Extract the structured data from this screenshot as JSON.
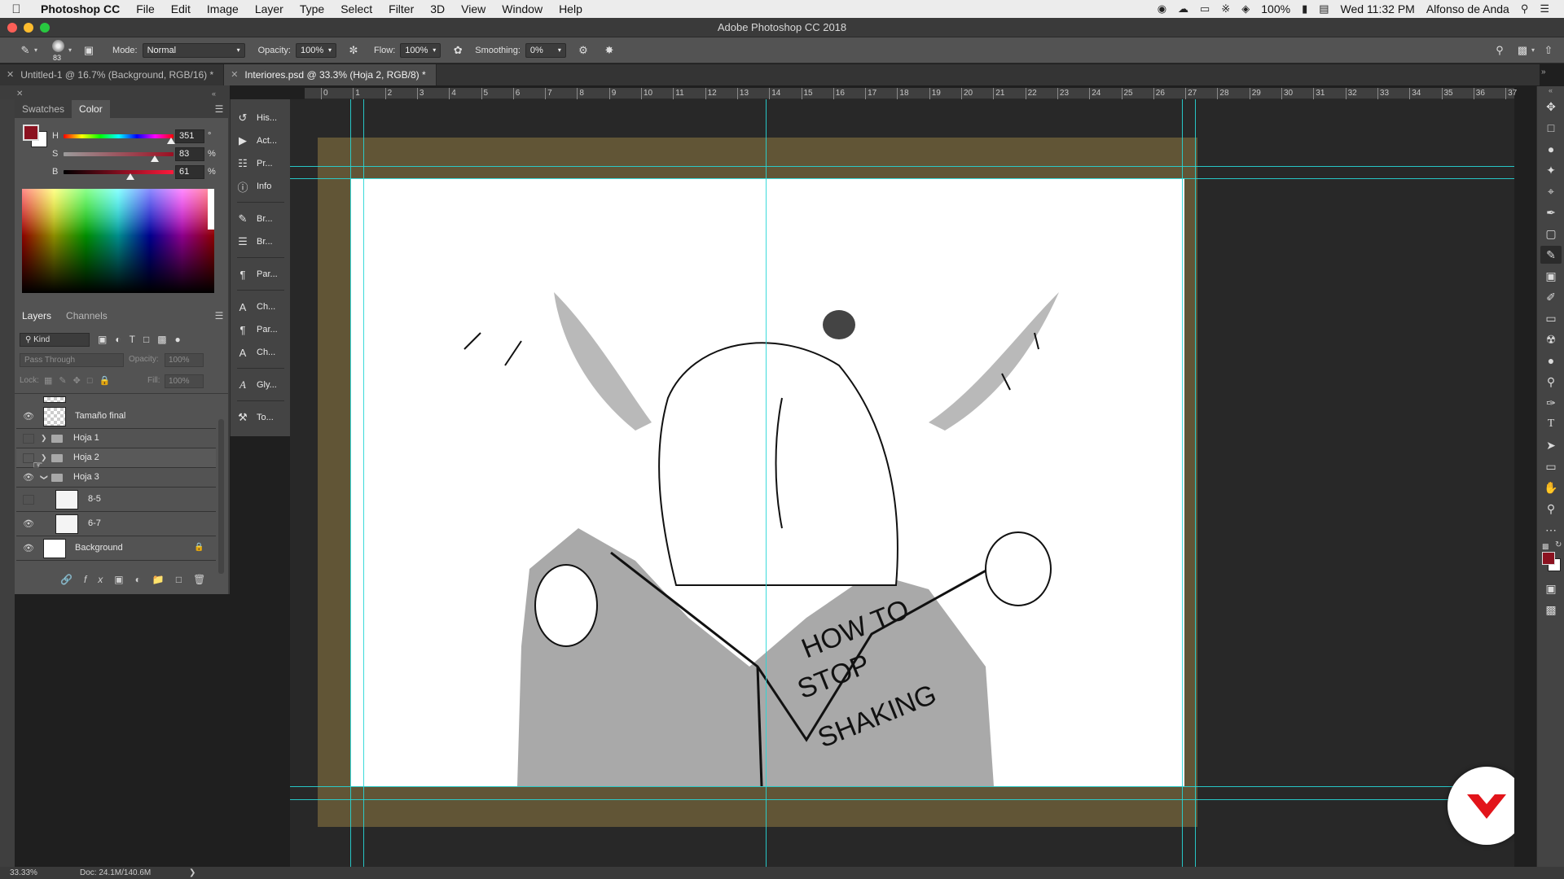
{
  "menubar": {
    "apple": "",
    "app_name": "Photoshop CC",
    "items": [
      "File",
      "Edit",
      "Image",
      "Layer",
      "Type",
      "Select",
      "Filter",
      "3D",
      "View",
      "Window",
      "Help"
    ],
    "battery": "100%",
    "clock": "Wed 11:32 PM",
    "user": "Alfonso de Anda"
  },
  "window": {
    "title": "Adobe Photoshop CC 2018"
  },
  "options": {
    "brush_size": "83",
    "mode_label": "Mode:",
    "mode_value": "Normal",
    "opacity_label": "Opacity:",
    "opacity_value": "100%",
    "flow_label": "Flow:",
    "flow_value": "100%",
    "smoothing_label": "Smoothing:",
    "smoothing_value": "0%"
  },
  "tabs": [
    {
      "label": "Untitled-1 @ 16.7% (Background, RGB/16) *"
    },
    {
      "label": "Interiores.psd @ 33.3% (Hoja 2, RGB/8) *"
    }
  ],
  "color_panel": {
    "tab_swatches": "Swatches",
    "tab_color": "Color",
    "foreground": "#8b1220",
    "h": {
      "label": "H",
      "value": "351",
      "unit": "°"
    },
    "s": {
      "label": "S",
      "value": "83",
      "unit": "%"
    },
    "b": {
      "label": "B",
      "value": "61",
      "unit": "%"
    }
  },
  "layers_panel": {
    "tab_layers": "Layers",
    "tab_channels": "Channels",
    "filter_kind": "Kind",
    "blend_mode": "Pass Through",
    "opacity_label": "Opacity:",
    "opacity_value": "100%",
    "lock_label": "Lock:",
    "fill_label": "Fill:",
    "fill_value": "100%",
    "layers": [
      {
        "name": "Tamaño final"
      },
      {
        "name": "Hoja 1"
      },
      {
        "name": "Hoja 2"
      },
      {
        "name": "Hoja 3"
      },
      {
        "name": "8-5"
      },
      {
        "name": "6-7"
      },
      {
        "name": "Background"
      }
    ]
  },
  "dock": {
    "items": [
      "His...",
      "Act...",
      "Pr...",
      "Info",
      "Br...",
      "Br...",
      "Par...",
      "Ch...",
      "Par...",
      "Ch...",
      "Gly...",
      "To..."
    ]
  },
  "ruler_h": [
    "0",
    "1",
    "2",
    "3",
    "4",
    "5",
    "6",
    "7",
    "8",
    "9",
    "10",
    "11",
    "12",
    "13",
    "14",
    "15",
    "16",
    "17",
    "18",
    "19",
    "20",
    "21",
    "22",
    "23",
    "24",
    "25",
    "26",
    "27",
    "28",
    "29",
    "30",
    "31",
    "32",
    "33",
    "34",
    "35",
    "36",
    "37"
  ],
  "artwork": {
    "book_text_1": "HOW TO",
    "book_text_2": "STOP",
    "book_text_3": "SHAKING"
  },
  "status": {
    "zoom": "33.33%",
    "doc": "Doc: 24.1M/140.6M"
  }
}
